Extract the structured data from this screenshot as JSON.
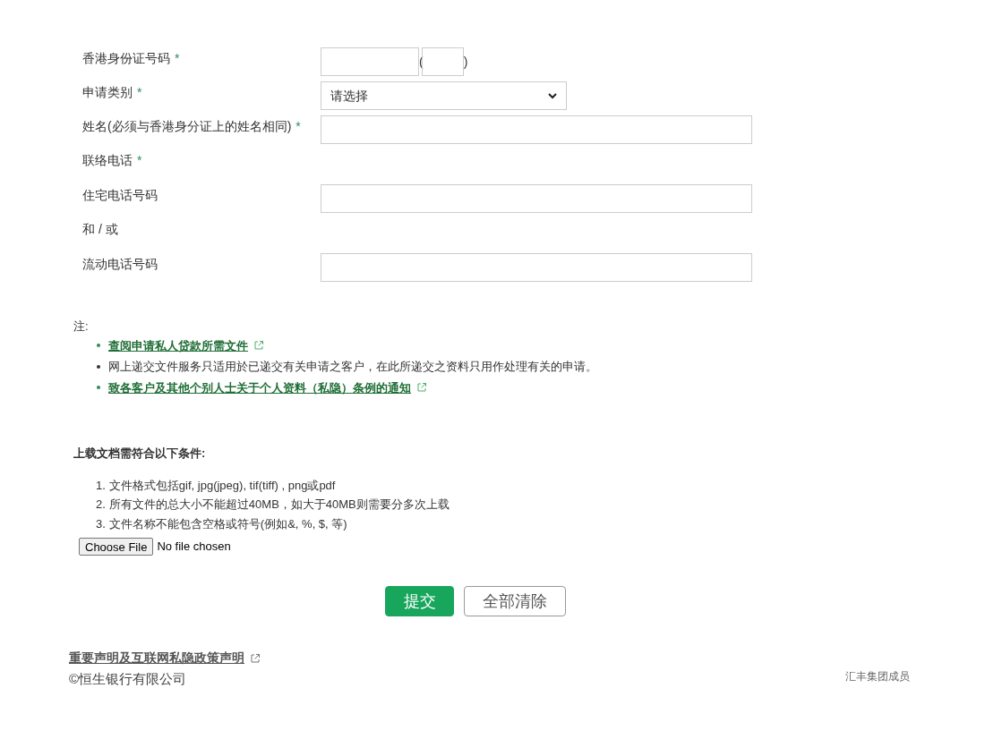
{
  "form": {
    "fields": [
      {
        "label": "香港身份证号码",
        "required": true,
        "kind": "id",
        "paren_open": "(",
        "paren_close": ")"
      },
      {
        "label": "申请类别",
        "required": true,
        "kind": "select",
        "value": "请选择"
      },
      {
        "label": "姓名(必须与香港身分证上的姓名相同)",
        "required": true,
        "kind": "text"
      },
      {
        "label": "联络电话",
        "required": true,
        "kind": "label"
      },
      {
        "label": "住宅电话号码",
        "required": false,
        "kind": "text"
      },
      {
        "label": "和 / 或",
        "required": false,
        "kind": "label"
      },
      {
        "label": "流动电话号码",
        "required": false,
        "kind": "text"
      }
    ],
    "required_mark": "*"
  },
  "notes": {
    "title": "注:",
    "items": [
      {
        "text": "查阅申请私人贷款所需文件",
        "kind": "link"
      },
      {
        "text": "网上递交文件服务只适用於已递交有关申请之客户，在此所递交之资料只用作处理有关的申请。",
        "kind": "text"
      },
      {
        "text": "致各客户及其他个别人士关于个人资料（私隐）条例的通知",
        "kind": "link"
      }
    ]
  },
  "upload": {
    "title": "上载文档需符合以下条件:",
    "conditions": [
      {
        "number": "1.",
        "text": "文件格式包括gif, jpg(jpeg), tif(tiff) , png或pdf"
      },
      {
        "number": "2.",
        "text": "所有文件的总大小不能超过40MB，如大于40MB则需要分多次上载"
      },
      {
        "number": "3.",
        "text": "文件名称不能包含空格或符号(例如&, %, $, 等)"
      }
    ],
    "file_button": "Choose File",
    "file_status": "No file chosen"
  },
  "buttons": [
    {
      "label": "提交",
      "kind": "primary"
    },
    {
      "label": "全部清除",
      "kind": "secondary"
    }
  ],
  "footer": {
    "link": "重要声明及互联网私隐政策声明",
    "copyright": "©恒生银行有限公司",
    "member": "汇丰集团成员"
  }
}
